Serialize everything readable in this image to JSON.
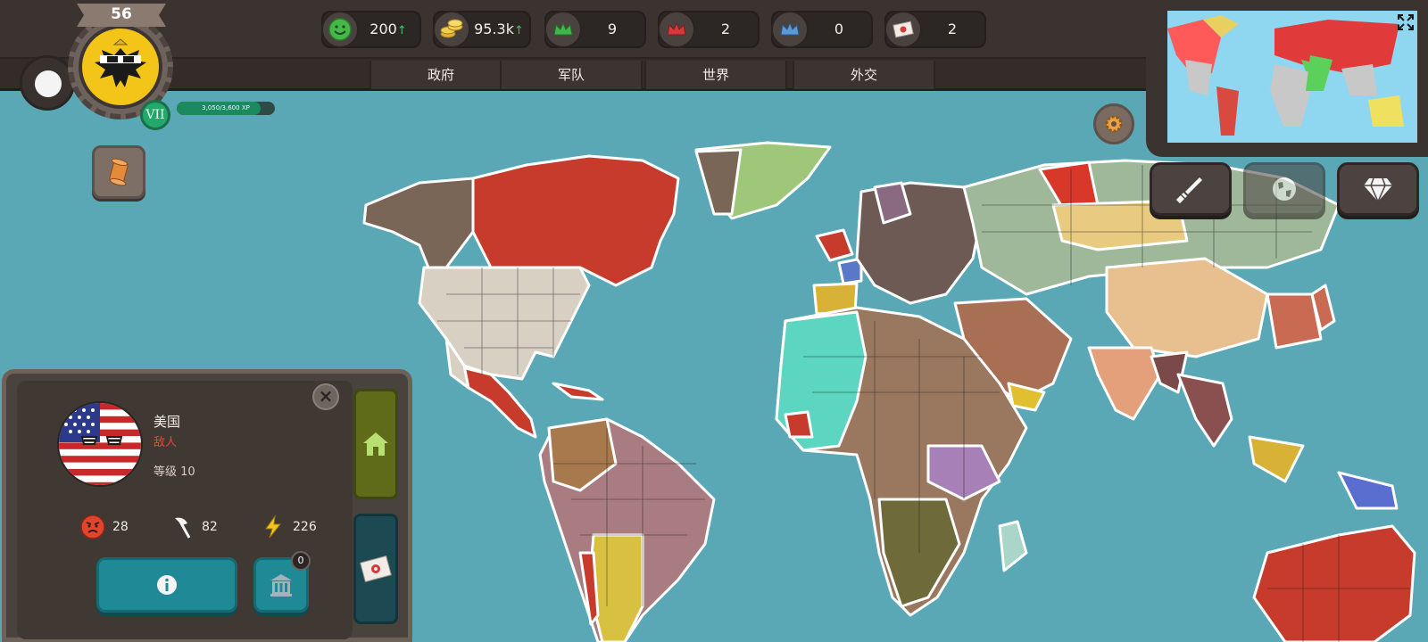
{
  "player": {
    "level": "56",
    "tier": "VII",
    "xp_text": "3,050/3,600 XP",
    "xp_fraction": 0.85
  },
  "resources": [
    {
      "name": "happiness",
      "icon": "smiley-icon",
      "value": "200",
      "trend": "↑"
    },
    {
      "name": "gold",
      "icon": "gold-coins-icon",
      "value": "95.3k",
      "trend": "↑"
    },
    {
      "name": "green-crown",
      "icon": "green-crown-icon",
      "value": "9",
      "trend": ""
    },
    {
      "name": "red-crown",
      "icon": "red-crown-icon",
      "value": "2",
      "trend": ""
    },
    {
      "name": "blue-crown",
      "icon": "blue-crown-icon",
      "value": "0",
      "trend": ""
    },
    {
      "name": "letters",
      "icon": "letter-icon",
      "value": "2",
      "trend": ""
    }
  ],
  "tabs": [
    {
      "label": "政府"
    },
    {
      "label": "军队"
    },
    {
      "label": "世界"
    },
    {
      "label": "外交"
    }
  ],
  "right_buttons": [
    {
      "name": "sword-button",
      "icon": "sword-icon"
    },
    {
      "name": "globe-button",
      "icon": "globe-icon"
    },
    {
      "name": "diamond-button",
      "icon": "diamond-icon"
    }
  ],
  "country_panel": {
    "name": "美国",
    "relation": "敌人",
    "level_text": "等级 10",
    "stats": {
      "anger": "28",
      "military": "82",
      "power": "226"
    },
    "building_count": "0"
  },
  "colors": {
    "ocean": "#5aa7b5",
    "enemy_red": "#e04b3a",
    "panel_brown": "#4a423c",
    "teal_button": "#1f8a96"
  }
}
